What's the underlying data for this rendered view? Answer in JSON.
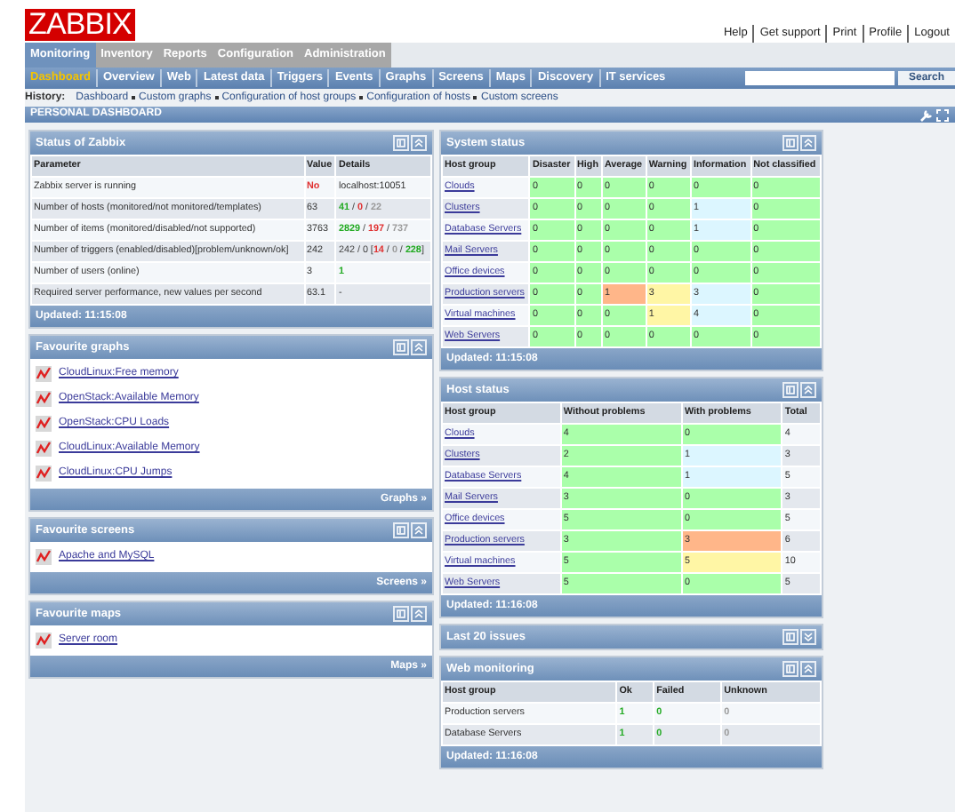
{
  "header": {
    "logo": "ZABBIX",
    "links": [
      "Help",
      "Get support",
      "Print",
      "Profile",
      "Logout"
    ]
  },
  "menu": [
    {
      "label": "Monitoring",
      "selected": true
    },
    {
      "label": "Inventory",
      "selected": false
    },
    {
      "label": "Reports",
      "selected": false
    },
    {
      "label": "Configuration",
      "selected": false
    },
    {
      "label": "Administration",
      "selected": false
    }
  ],
  "submenu": [
    {
      "label": "Dashboard",
      "selected": true
    },
    {
      "label": "Overview",
      "selected": false
    },
    {
      "label": "Web",
      "selected": false
    },
    {
      "label": "Latest data",
      "selected": false
    },
    {
      "label": "Triggers",
      "selected": false
    },
    {
      "label": "Events",
      "selected": false
    },
    {
      "label": "Graphs",
      "selected": false
    },
    {
      "label": "Screens",
      "selected": false
    },
    {
      "label": "Maps",
      "selected": false
    },
    {
      "label": "Discovery",
      "selected": false
    },
    {
      "label": "IT services",
      "selected": false
    }
  ],
  "search": {
    "button": "Search"
  },
  "history": {
    "label": "History:",
    "items": [
      "Dashboard",
      "Custom graphs",
      "Configuration of host groups",
      "Configuration of hosts",
      "Custom screens"
    ]
  },
  "page_title": "PERSONAL DASHBOARD",
  "left_panels": [
    {
      "title": "Status of Zabbix",
      "kind": "table",
      "expanded": true,
      "columns": [
        "Parameter",
        "Value",
        "Details"
      ],
      "rows": [
        [
          {
            "kind": "plain",
            "text": "Zabbix server is running"
          },
          {
            "kind": "plain",
            "text": "No",
            "color": "#e03030"
          },
          {
            "kind": "plain",
            "text": "localhost:10051"
          }
        ],
        [
          {
            "kind": "plain",
            "text": "Number of hosts (monitored/not monitored/templates)"
          },
          {
            "kind": "plain",
            "text": "63"
          },
          {
            "kind": "parts",
            "parts": [
              {
                "text": "41",
                "color": "#22aa22"
              },
              {
                "text": " / "
              },
              {
                "text": "0",
                "color": "#e03030"
              },
              {
                "text": " / "
              },
              {
                "text": "22",
                "color": "#999999"
              }
            ]
          }
        ],
        [
          {
            "kind": "plain",
            "text": "Number of items (monitored/disabled/not supported)"
          },
          {
            "kind": "plain",
            "text": "3763"
          },
          {
            "kind": "parts",
            "parts": [
              {
                "text": "2829",
                "color": "#22aa22"
              },
              {
                "text": " / "
              },
              {
                "text": "197",
                "color": "#e03030"
              },
              {
                "text": " / "
              },
              {
                "text": "737",
                "color": "#999999"
              }
            ]
          }
        ],
        [
          {
            "kind": "plain",
            "text": "Number of triggers (enabled/disabled)[problem/unknown/ok]"
          },
          {
            "kind": "plain",
            "text": "242"
          },
          {
            "kind": "parts",
            "parts": [
              {
                "text": "242 / 0  ["
              },
              {
                "text": "14",
                "color": "#e03030"
              },
              {
                "text": " / "
              },
              {
                "text": "0",
                "color": "#999999"
              },
              {
                "text": " / "
              },
              {
                "text": "228",
                "color": "#22aa22"
              },
              {
                "text": "]"
              }
            ]
          }
        ],
        [
          {
            "kind": "plain",
            "text": "Number of users (online)"
          },
          {
            "kind": "plain",
            "text": "3"
          },
          {
            "kind": "plain",
            "text": "1",
            "color": "#22aa22"
          }
        ],
        [
          {
            "kind": "plain",
            "text": "Required server performance, new values per second"
          },
          {
            "kind": "plain",
            "text": "63.1"
          },
          {
            "kind": "plain",
            "text": "-"
          }
        ]
      ],
      "footer": {
        "kind": "status",
        "text": "Updated: 11:15:08"
      }
    },
    {
      "title": "Favourite graphs",
      "kind": "links",
      "expanded": true,
      "items": [
        "CloudLinux:Free memory",
        "OpenStack:Available Memory",
        "OpenStack:CPU Loads",
        "CloudLinux:Available Memory",
        "CloudLinux:CPU Jumps"
      ],
      "footer": {
        "kind": "link",
        "text": "Graphs »"
      }
    },
    {
      "title": "Favourite screens",
      "kind": "links",
      "expanded": true,
      "items": [
        "Apache and MySQL"
      ],
      "footer": {
        "kind": "link",
        "text": "Screens »"
      }
    },
    {
      "title": "Favourite maps",
      "kind": "links",
      "expanded": true,
      "items": [
        "Server room"
      ],
      "footer": {
        "kind": "link",
        "text": "Maps »"
      }
    }
  ],
  "right_panels": [
    {
      "title": "System status",
      "kind": "table",
      "expanded": true,
      "columns": [
        "Host group",
        "Disaster",
        "High",
        "Average",
        "Warning",
        "Information",
        "Not classified"
      ],
      "rows": [
        [
          {
            "kind": "link",
            "text": "Clouds"
          },
          {
            "kind": "fill",
            "text": "0",
            "color": "#aaffaa"
          },
          {
            "kind": "fill",
            "text": "0",
            "color": "#aaffaa"
          },
          {
            "kind": "fill",
            "text": "0",
            "color": "#aaffaa"
          },
          {
            "kind": "fill",
            "text": "0",
            "color": "#aaffaa"
          },
          {
            "kind": "fill",
            "text": "0",
            "color": "#aaffaa"
          },
          {
            "kind": "fill",
            "text": "0",
            "color": "#aaffaa"
          }
        ],
        [
          {
            "kind": "link",
            "text": "Clusters"
          },
          {
            "kind": "fill",
            "text": "0",
            "color": "#aaffaa"
          },
          {
            "kind": "fill",
            "text": "0",
            "color": "#aaffaa"
          },
          {
            "kind": "fill",
            "text": "0",
            "color": "#aaffaa"
          },
          {
            "kind": "fill",
            "text": "0",
            "color": "#aaffaa"
          },
          {
            "kind": "fill",
            "text": "1",
            "color": "#dcf6ff"
          },
          {
            "kind": "fill",
            "text": "0",
            "color": "#aaffaa"
          }
        ],
        [
          {
            "kind": "link",
            "text": "Database Servers"
          },
          {
            "kind": "fill",
            "text": "0",
            "color": "#aaffaa"
          },
          {
            "kind": "fill",
            "text": "0",
            "color": "#aaffaa"
          },
          {
            "kind": "fill",
            "text": "0",
            "color": "#aaffaa"
          },
          {
            "kind": "fill",
            "text": "0",
            "color": "#aaffaa"
          },
          {
            "kind": "fill",
            "text": "1",
            "color": "#dcf6ff"
          },
          {
            "kind": "fill",
            "text": "0",
            "color": "#aaffaa"
          }
        ],
        [
          {
            "kind": "link",
            "text": "Mail Servers"
          },
          {
            "kind": "fill",
            "text": "0",
            "color": "#aaffaa"
          },
          {
            "kind": "fill",
            "text": "0",
            "color": "#aaffaa"
          },
          {
            "kind": "fill",
            "text": "0",
            "color": "#aaffaa"
          },
          {
            "kind": "fill",
            "text": "0",
            "color": "#aaffaa"
          },
          {
            "kind": "fill",
            "text": "0",
            "color": "#aaffaa"
          },
          {
            "kind": "fill",
            "text": "0",
            "color": "#aaffaa"
          }
        ],
        [
          {
            "kind": "link",
            "text": "Office devices"
          },
          {
            "kind": "fill",
            "text": "0",
            "color": "#aaffaa"
          },
          {
            "kind": "fill",
            "text": "0",
            "color": "#aaffaa"
          },
          {
            "kind": "fill",
            "text": "0",
            "color": "#aaffaa"
          },
          {
            "kind": "fill",
            "text": "0",
            "color": "#aaffaa"
          },
          {
            "kind": "fill",
            "text": "0",
            "color": "#aaffaa"
          },
          {
            "kind": "fill",
            "text": "0",
            "color": "#aaffaa"
          }
        ],
        [
          {
            "kind": "link",
            "text": "Production servers"
          },
          {
            "kind": "fill",
            "text": "0",
            "color": "#aaffaa"
          },
          {
            "kind": "fill",
            "text": "0",
            "color": "#aaffaa"
          },
          {
            "kind": "fill",
            "text": "1",
            "color": "#ffb689"
          },
          {
            "kind": "fill",
            "text": "3",
            "color": "#fff6a5"
          },
          {
            "kind": "fill",
            "text": "3",
            "color": "#dcf6ff"
          },
          {
            "kind": "fill",
            "text": "0",
            "color": "#aaffaa"
          }
        ],
        [
          {
            "kind": "link",
            "text": "Virtual machines"
          },
          {
            "kind": "fill",
            "text": "0",
            "color": "#aaffaa"
          },
          {
            "kind": "fill",
            "text": "0",
            "color": "#aaffaa"
          },
          {
            "kind": "fill",
            "text": "0",
            "color": "#aaffaa"
          },
          {
            "kind": "fill",
            "text": "1",
            "color": "#fff6a5"
          },
          {
            "kind": "fill",
            "text": "4",
            "color": "#dcf6ff"
          },
          {
            "kind": "fill",
            "text": "0",
            "color": "#aaffaa"
          }
        ],
        [
          {
            "kind": "link",
            "text": "Web Servers"
          },
          {
            "kind": "fill",
            "text": "0",
            "color": "#aaffaa"
          },
          {
            "kind": "fill",
            "text": "0",
            "color": "#aaffaa"
          },
          {
            "kind": "fill",
            "text": "0",
            "color": "#aaffaa"
          },
          {
            "kind": "fill",
            "text": "0",
            "color": "#aaffaa"
          },
          {
            "kind": "fill",
            "text": "0",
            "color": "#aaffaa"
          },
          {
            "kind": "fill",
            "text": "0",
            "color": "#aaffaa"
          }
        ]
      ],
      "footer": {
        "kind": "status",
        "text": "Updated: 11:15:08"
      }
    },
    {
      "title": "Host status",
      "kind": "table",
      "expanded": true,
      "columns": [
        "Host group",
        "Without problems",
        "With problems",
        "Total"
      ],
      "rows": [
        [
          {
            "kind": "link",
            "text": "Clouds"
          },
          {
            "kind": "fill",
            "text": "4",
            "color": "#aaffaa"
          },
          {
            "kind": "fill",
            "text": "0",
            "color": "#aaffaa"
          },
          {
            "kind": "plain",
            "text": "4"
          }
        ],
        [
          {
            "kind": "link",
            "text": "Clusters"
          },
          {
            "kind": "fill",
            "text": "2",
            "color": "#aaffaa"
          },
          {
            "kind": "fill",
            "text": "1",
            "color": "#dcf6ff"
          },
          {
            "kind": "plain",
            "text": "3"
          }
        ],
        [
          {
            "kind": "link",
            "text": "Database Servers"
          },
          {
            "kind": "fill",
            "text": "4",
            "color": "#aaffaa"
          },
          {
            "kind": "fill",
            "text": "1",
            "color": "#dcf6ff"
          },
          {
            "kind": "plain",
            "text": "5"
          }
        ],
        [
          {
            "kind": "link",
            "text": "Mail Servers"
          },
          {
            "kind": "fill",
            "text": "3",
            "color": "#aaffaa"
          },
          {
            "kind": "fill",
            "text": "0",
            "color": "#aaffaa"
          },
          {
            "kind": "plain",
            "text": "3"
          }
        ],
        [
          {
            "kind": "link",
            "text": "Office devices"
          },
          {
            "kind": "fill",
            "text": "5",
            "color": "#aaffaa"
          },
          {
            "kind": "fill",
            "text": "0",
            "color": "#aaffaa"
          },
          {
            "kind": "plain",
            "text": "5"
          }
        ],
        [
          {
            "kind": "link",
            "text": "Production servers"
          },
          {
            "kind": "fill",
            "text": "3",
            "color": "#aaffaa"
          },
          {
            "kind": "fill",
            "text": "3",
            "color": "#ffb689"
          },
          {
            "kind": "plain",
            "text": "6"
          }
        ],
        [
          {
            "kind": "link",
            "text": "Virtual machines"
          },
          {
            "kind": "fill",
            "text": "5",
            "color": "#aaffaa"
          },
          {
            "kind": "fill",
            "text": "5",
            "color": "#fff6a5"
          },
          {
            "kind": "plain",
            "text": "10"
          }
        ],
        [
          {
            "kind": "link",
            "text": "Web Servers"
          },
          {
            "kind": "fill",
            "text": "5",
            "color": "#aaffaa"
          },
          {
            "kind": "fill",
            "text": "0",
            "color": "#aaffaa"
          },
          {
            "kind": "plain",
            "text": "5"
          }
        ]
      ],
      "footer": {
        "kind": "status",
        "text": "Updated: 11:16:08"
      }
    },
    {
      "title": "Last 20 issues",
      "expanded": false
    },
    {
      "title": "Web monitoring",
      "kind": "table",
      "expanded": true,
      "columns": [
        "Host group",
        "Ok",
        "Failed",
        "Unknown"
      ],
      "rows": [
        [
          {
            "kind": "plain",
            "text": "Production servers"
          },
          {
            "kind": "plain",
            "text": "1",
            "color": "#22aa22"
          },
          {
            "kind": "plain",
            "text": "0",
            "color": "#22aa22"
          },
          {
            "kind": "plain",
            "text": "0",
            "color": "#999999"
          }
        ],
        [
          {
            "kind": "plain",
            "text": "Database Servers"
          },
          {
            "kind": "plain",
            "text": "1",
            "color": "#22aa22"
          },
          {
            "kind": "plain",
            "text": "0",
            "color": "#22aa22"
          },
          {
            "kind": "plain",
            "text": "0",
            "color": "#999999"
          }
        ]
      ],
      "footer": {
        "kind": "status",
        "text": "Updated: 11:16:08"
      }
    }
  ]
}
